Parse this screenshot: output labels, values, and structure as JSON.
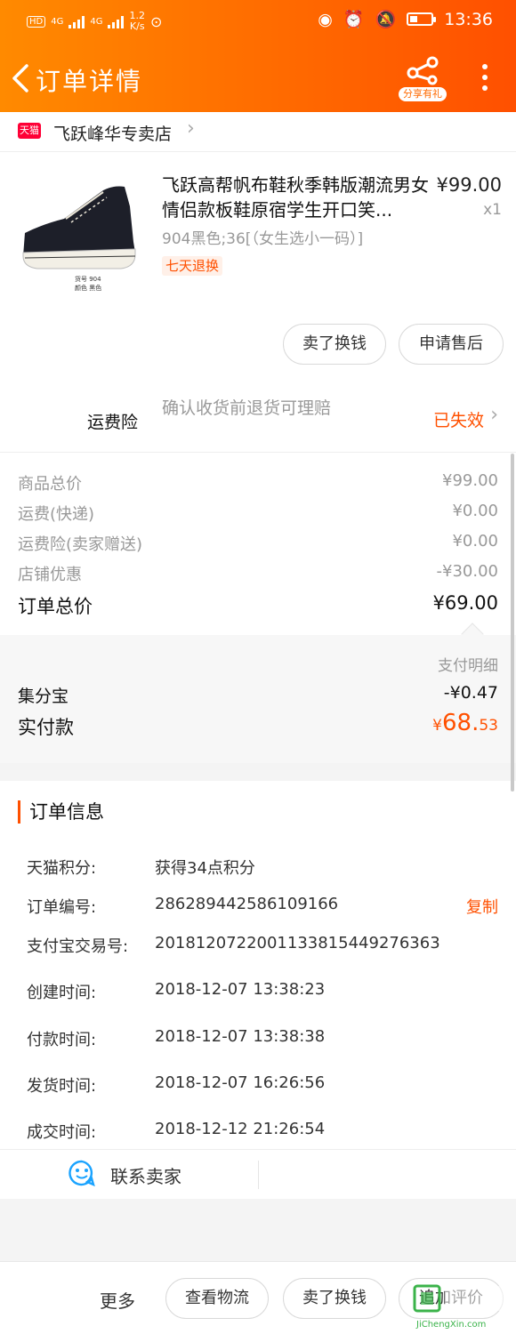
{
  "status_bar": {
    "left_badges": [
      "HD",
      "4G",
      "4G"
    ],
    "net_speed": "1.2\nK/s",
    "time": "13:36"
  },
  "nav": {
    "title": "订单详情",
    "share_label": "分享有礼",
    "icons": [
      "back-arrow-icon",
      "share-icon",
      "more-icon"
    ]
  },
  "shop": {
    "badge": "天猫",
    "name": "飞跃峰华专卖店"
  },
  "product": {
    "title": "飞跃高帮帆布鞋秋季韩版潮流男女情侣款板鞋原宿学生开口笑...",
    "price": "¥99.00",
    "qty": "x1",
    "sku": "904黑色;36[（女生选小一码）]",
    "badge": "七天退换",
    "thumb_caption_1": "货号  904",
    "thumb_caption_2": "颜色  黑色"
  },
  "actions": {
    "sell": "卖了换钱",
    "after_sale": "申请售后"
  },
  "insurance": {
    "label": "运费险",
    "desc": "确认收货前退货可理赔",
    "status": "已失效"
  },
  "fees": {
    "goods_label": "商品总价",
    "goods_value": "¥99.00",
    "ship_label": "运费(快递)",
    "ship_value": "¥0.00",
    "ins_label": "运费险(卖家赠送)",
    "ins_value": "¥0.00",
    "discount_label": "店铺优惠",
    "discount_value": "-¥30.00",
    "total_label": "订单总价",
    "total_value": "¥69.00"
  },
  "payment": {
    "detail_label": "支付明细",
    "jfb_label": "集分宝",
    "jfb_value": "-¥0.47",
    "paid_label": "实付款",
    "paid_currency": "¥",
    "paid_int": "68.",
    "paid_dec": "53"
  },
  "order_info": {
    "title": "订单信息",
    "rows": [
      {
        "k": "天猫积分:",
        "v": "获得34点积分"
      },
      {
        "k": "订单编号:",
        "v": "286289442586109166"
      },
      {
        "k": "支付宝交易号:",
        "v": "2018120722001133815449276363"
      },
      {
        "k": "创建时间:",
        "v": "2018-12-07 13:38:23"
      },
      {
        "k": "付款时间:",
        "v": "2018-12-07 13:38:38"
      },
      {
        "k": "发货时间:",
        "v": "2018-12-07 16:26:56"
      },
      {
        "k": "成交时间:",
        "v": "2018-12-12 21:26:54"
      }
    ],
    "copy_label": "复制"
  },
  "contact": {
    "label": "联系卖家"
  },
  "bottom_bar": {
    "more": "更多",
    "logistics": "查看物流",
    "sell": "卖了换钱",
    "review": "追加评价"
  },
  "watermark": {
    "text": "JiChengXin.com"
  },
  "colors": {
    "brand_orange": "#ff5000",
    "header_start": "#ff8a00"
  }
}
